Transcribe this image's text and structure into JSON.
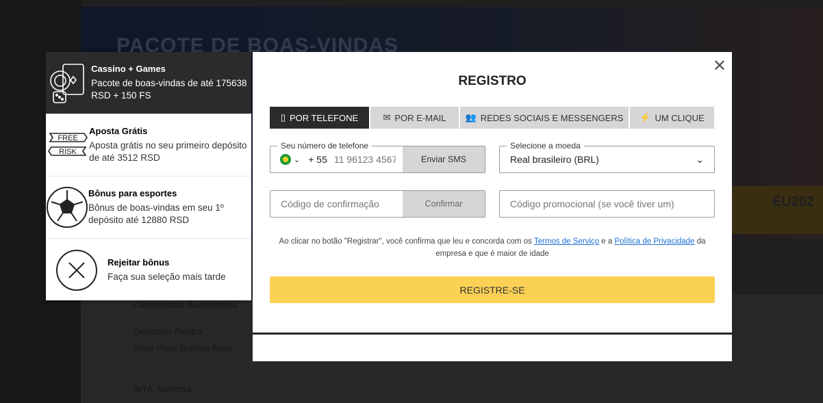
{
  "background": {
    "banner_title": "PACOTE DE BOAS-VINDAS",
    "promo": "EU202",
    "rows": [
      "Campeonato da Argentina",
      "Deportivo Riestra",
      "River Plate Buenos Aires",
      "WTA. Valência"
    ]
  },
  "bonuses": [
    {
      "title": "Cassino + Games",
      "desc": "Pacote de boas-vindas de até 175638 RSD + 150 FS",
      "icon": "casino-icon"
    },
    {
      "title": "Aposta Grátis",
      "desc": "Aposta grátis no seu primeiro depósito de até 3512 RSD",
      "icon": "free-risk-icon",
      "icon_text": [
        "FREE",
        "RISK"
      ]
    },
    {
      "title": "Bônus para esportes",
      "desc": "Bônus de boas-vindas em seu 1º depósito até 12880 RSD",
      "icon": "soccer-ball-icon"
    },
    {
      "title": "Rejeitar bônus",
      "desc": "Faça sua seleção mais tarde",
      "icon": "reject-icon"
    }
  ],
  "modal": {
    "title": "REGISTRO",
    "tabs": [
      {
        "label": "POR TELEFONE",
        "icon": "phone-icon"
      },
      {
        "label": "POR E-MAIL",
        "icon": "envelope-icon"
      },
      {
        "label": "REDES SOCIAIS E MESSENGERS",
        "icon": "users-icon"
      },
      {
        "label": "UM CLIQUE",
        "icon": "lightning-icon"
      }
    ],
    "phone": {
      "legend": "Seu número de telefone",
      "code": "+ 55",
      "placeholder": "11 96123 4567",
      "send": "Enviar SMS"
    },
    "currency": {
      "legend": "Selecione a moeda",
      "value": "Real brasileiro (BRL)"
    },
    "code": {
      "placeholder": "Código de confirmação",
      "confirm": "Confirmar"
    },
    "promo": {
      "placeholder": "Código promocional (se você tiver um)"
    },
    "terms": {
      "pre": "Ao clicar no botão \"Registrar\", você confirma que leu e concorda com os ",
      "tos": "Termos de Serviço",
      "mid": " e a ",
      "privacy": "Política de Privacidade",
      "post": " da empresa e que é maior de idade"
    },
    "submit": "REGISTRE-SE"
  },
  "colors": {
    "accent": "#fad155",
    "dark": "#2b2b2b",
    "link": "#1a6fd0"
  }
}
